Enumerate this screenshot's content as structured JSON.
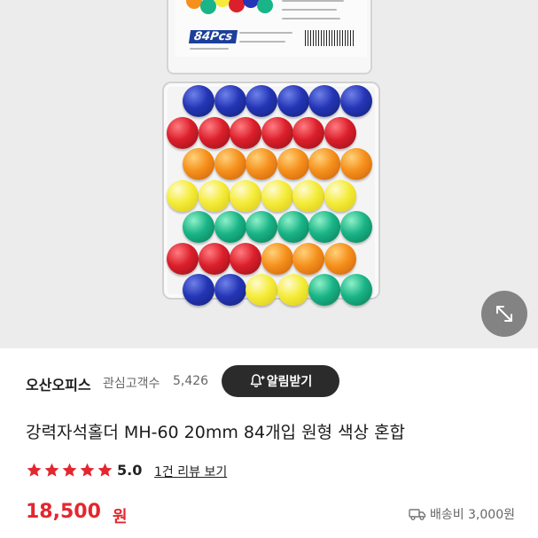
{
  "product_image": {
    "package_badge": "84Pcs"
  },
  "seller": {
    "name": "오산오피스",
    "interest_label": "관심고객수",
    "interest_count": "5,426",
    "alert_button_label": "알림받기"
  },
  "product": {
    "title": "강력자석홀더 MH-60 20mm 84개입 원형 색상 혼합",
    "rating": "5.0",
    "star_count": 5,
    "review_link_label": "1건 리뷰 보기",
    "price": "18,500",
    "price_unit": "원",
    "shipping_label": "배송비 3,000원"
  },
  "colors": {
    "price": "#e4262f",
    "star": "#e4262f",
    "alert_button_bg": "#2b2b2b"
  },
  "icons": {
    "zoom": "expand-icon",
    "alert": "bell-plus-icon",
    "shipping": "truck-icon"
  },
  "magnet_grid": [
    [
      "blue",
      "blue",
      "blue",
      "blue",
      "blue",
      "blue"
    ],
    [
      "red",
      "red",
      "red",
      "red",
      "red",
      "red"
    ],
    [
      "orange",
      "orange",
      "orange",
      "orange",
      "orange",
      "orange"
    ],
    [
      "yellow",
      "yellow",
      "yellow",
      "yellow",
      "yellow",
      "yellow"
    ],
    [
      "green",
      "green",
      "green",
      "green",
      "green",
      "green"
    ],
    [
      "red",
      "red",
      "red",
      "orange",
      "orange",
      "orange"
    ],
    [
      "blue",
      "blue",
      "yellow",
      "yellow",
      "green",
      "green"
    ]
  ]
}
